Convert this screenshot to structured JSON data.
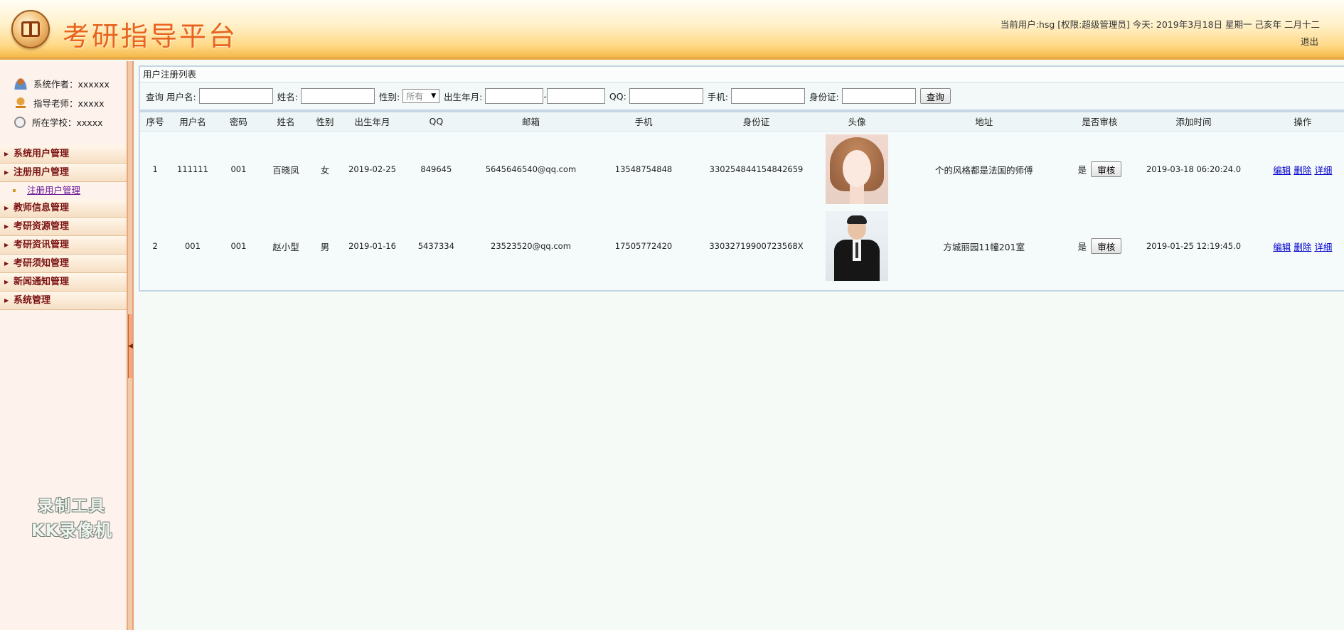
{
  "header": {
    "title": "考研指导平台",
    "user_info": "当前用户:hsg [权限:超级管理员] 今天: 2019年3月18日 星期一 己亥年 二月十二",
    "logout": "退出"
  },
  "sidebar": {
    "info": [
      {
        "label": "系统作者：xxxxxx",
        "icon": "author-icon"
      },
      {
        "label": "指导老师：xxxxx",
        "icon": "teacher-icon"
      },
      {
        "label": "所在学校：xxxxx",
        "icon": "school-icon"
      }
    ],
    "menu": [
      {
        "label": "系统用户管理"
      },
      {
        "label": "注册用户管理",
        "sub": [
          "注册用户管理"
        ]
      },
      {
        "label": "教师信息管理"
      },
      {
        "label": "考研资源管理"
      },
      {
        "label": "考研资讯管理"
      },
      {
        "label": "考研须知管理"
      },
      {
        "label": "新闻通知管理"
      },
      {
        "label": "系统管理"
      }
    ],
    "watermark": {
      "line1": "录制工具",
      "line2": "KK录像机"
    }
  },
  "main": {
    "panel_title": "用户注册列表",
    "search": {
      "query_label": "查询",
      "username_label": "用户名:",
      "name_label": "姓名:",
      "gender_label": "性别:",
      "gender_value": "所有",
      "birth_label": "出生年月:",
      "birth_sep": "-",
      "qq_label": "QQ:",
      "phone_label": "手机:",
      "idcard_label": "身份证:",
      "search_button": "查询"
    },
    "columns": [
      "序号",
      "用户名",
      "密码",
      "姓名",
      "性别",
      "出生年月",
      "QQ",
      "邮箱",
      "手机",
      "身份证",
      "头像",
      "地址",
      "是否审核",
      "添加时间",
      "操作"
    ],
    "rows": [
      {
        "no": "1",
        "username": "111111",
        "password": "001",
        "name": "百晓凤",
        "gender": "女",
        "birth": "2019-02-25",
        "qq": "849645",
        "email": "5645646540@qq.com",
        "phone": "13548754848",
        "idcard": "330254844154842659",
        "avatar": "female-avatar",
        "address": "个的风格都是法国的师傅",
        "audited": "是",
        "audit_btn": "审核",
        "added": "2019-03-18 06:20:24.0",
        "ops": [
          "编辑",
          "删除",
          "详细"
        ]
      },
      {
        "no": "2",
        "username": "001",
        "password": "001",
        "name": "赵小型",
        "gender": "男",
        "birth": "2019-01-16",
        "qq": "5437334",
        "email": "23523520@qq.com",
        "phone": "17505772420",
        "idcard": "33032719900723568X",
        "avatar": "male-avatar",
        "address": "方城丽园11幢201室",
        "audited": "是",
        "audit_btn": "审核",
        "added": "2019-01-25 12:19:45.0",
        "ops": [
          "编辑",
          "删除",
          "详细"
        ]
      }
    ]
  }
}
